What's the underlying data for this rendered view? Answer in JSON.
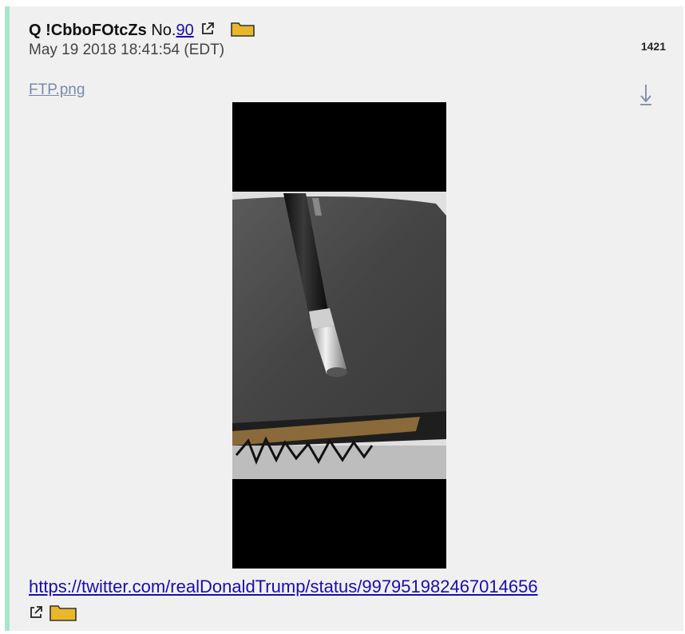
{
  "post": {
    "author": "Q !CbboFOtcZs",
    "number_prefix": "No.",
    "number": "90",
    "date": "May 19 2018 18:41:54 (EDT)",
    "reply_count": "1421",
    "filename": "FTP.png",
    "link": "https://twitter.com/realDonaldTrump/status/997951982467014656"
  },
  "icons": {
    "external": "external-link-icon",
    "folder": "folder-icon",
    "download": "download-arrow-icon"
  },
  "colors": {
    "accent_border": "#a8e6cc",
    "link": "#1a0dab",
    "folder": "#e8b82a"
  }
}
